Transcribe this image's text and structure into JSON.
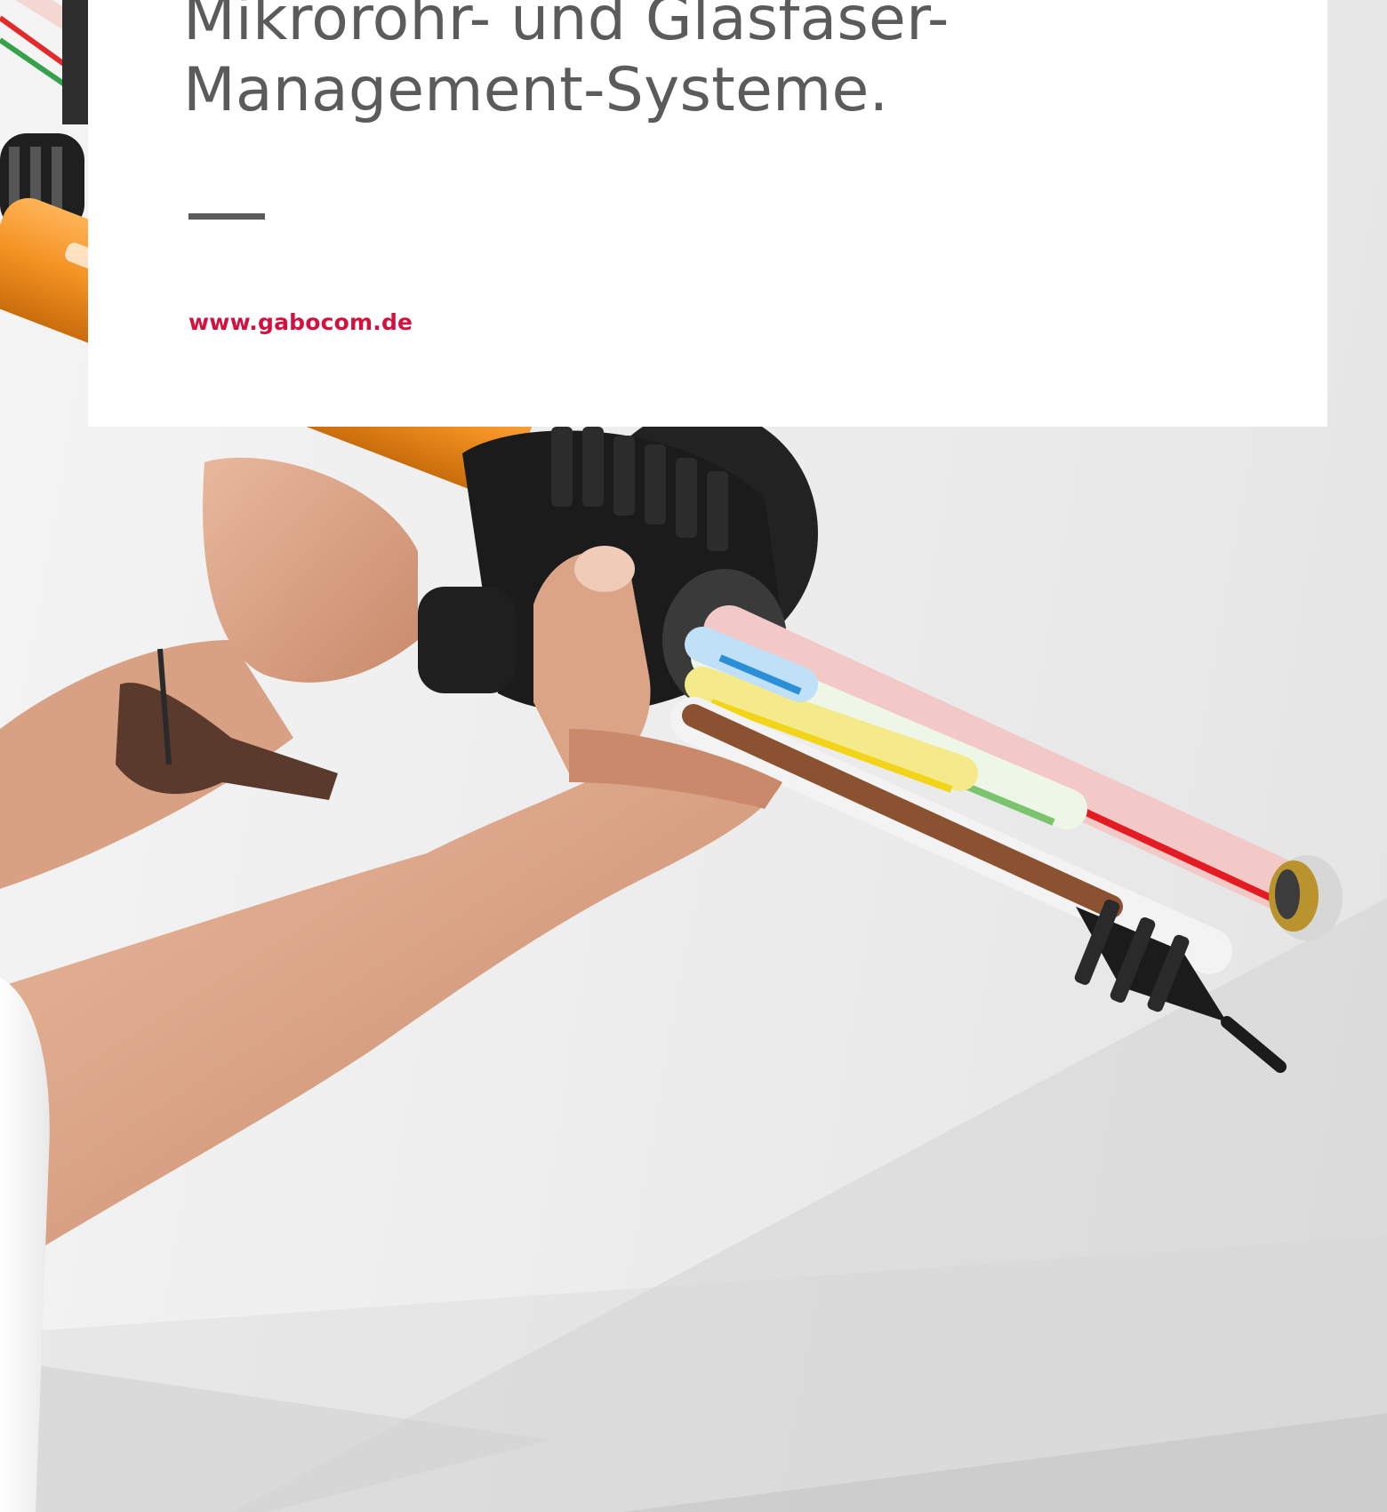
{
  "headline": {
    "line1": "Mikrorohr- und Glasfaser-",
    "line2": "Management-Systeme."
  },
  "website": "www.gabocom.de",
  "colors": {
    "headline": "#5b5b5b",
    "link": "#d4103f",
    "card": "#ffffff",
    "tube_orange": "#f3982b",
    "connector": "#1b1b1b",
    "skin": "#d9a184"
  },
  "photo": {
    "subject": "hands-holding-microduct-connector",
    "icon": "photo-icon"
  }
}
